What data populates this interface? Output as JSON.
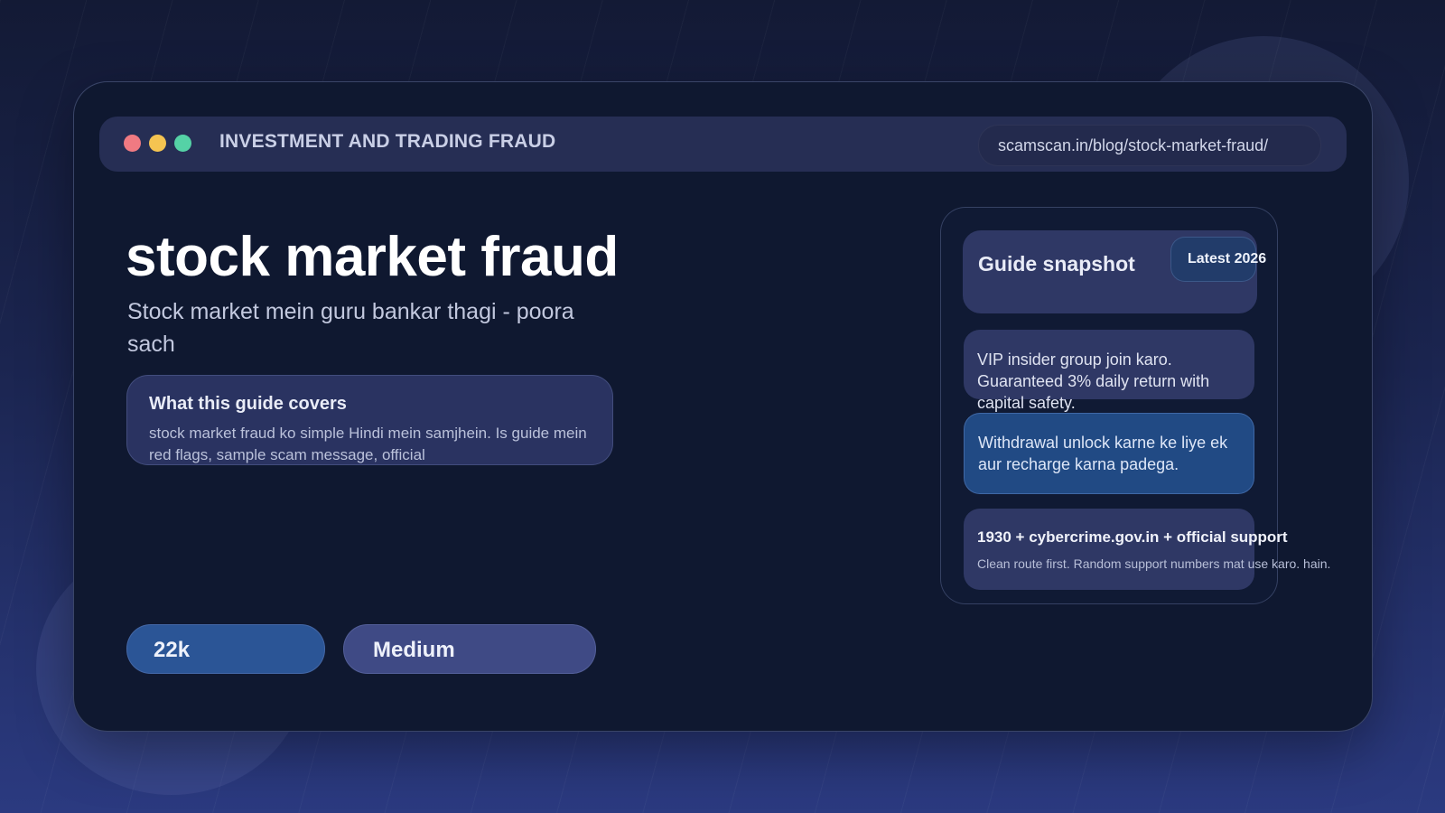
{
  "window": {
    "title": "INVESTMENT AND TRADING FRAUD",
    "url": "scamscan.in/blog/stock-market-fraud/",
    "controls": [
      "close",
      "minimize",
      "maximize"
    ]
  },
  "hero": {
    "title": "stock market fraud",
    "subtitle": "Stock market mein guru bankar thagi - poora sach"
  },
  "covers": {
    "heading": "What this guide covers",
    "text": "stock market fraud ko simple Hindi mein samjhein. Is guide mein red flags, sample scam message, official"
  },
  "stats": {
    "views": "22k",
    "difficulty": "Medium"
  },
  "snapshot": {
    "title": "Guide snapshot",
    "badge": "Latest 2026",
    "scam_message": "VIP insider group join karo. Guaranteed 3% daily return with capital safety.",
    "recharge_message": "Withdrawal unlock karne ke liye ek aur recharge karna padega.",
    "support_title": "1930 + cybercrime.gov.in + official support",
    "support_text": "Clean route first. Random support numbers mat use karo. hain."
  },
  "colors": {
    "background": "#1b2550",
    "window": "#0f1830",
    "accent_blue": "#2b5596",
    "dot_red": "#f07a82",
    "dot_yellow": "#f5c451",
    "dot_green": "#55d2a6"
  }
}
